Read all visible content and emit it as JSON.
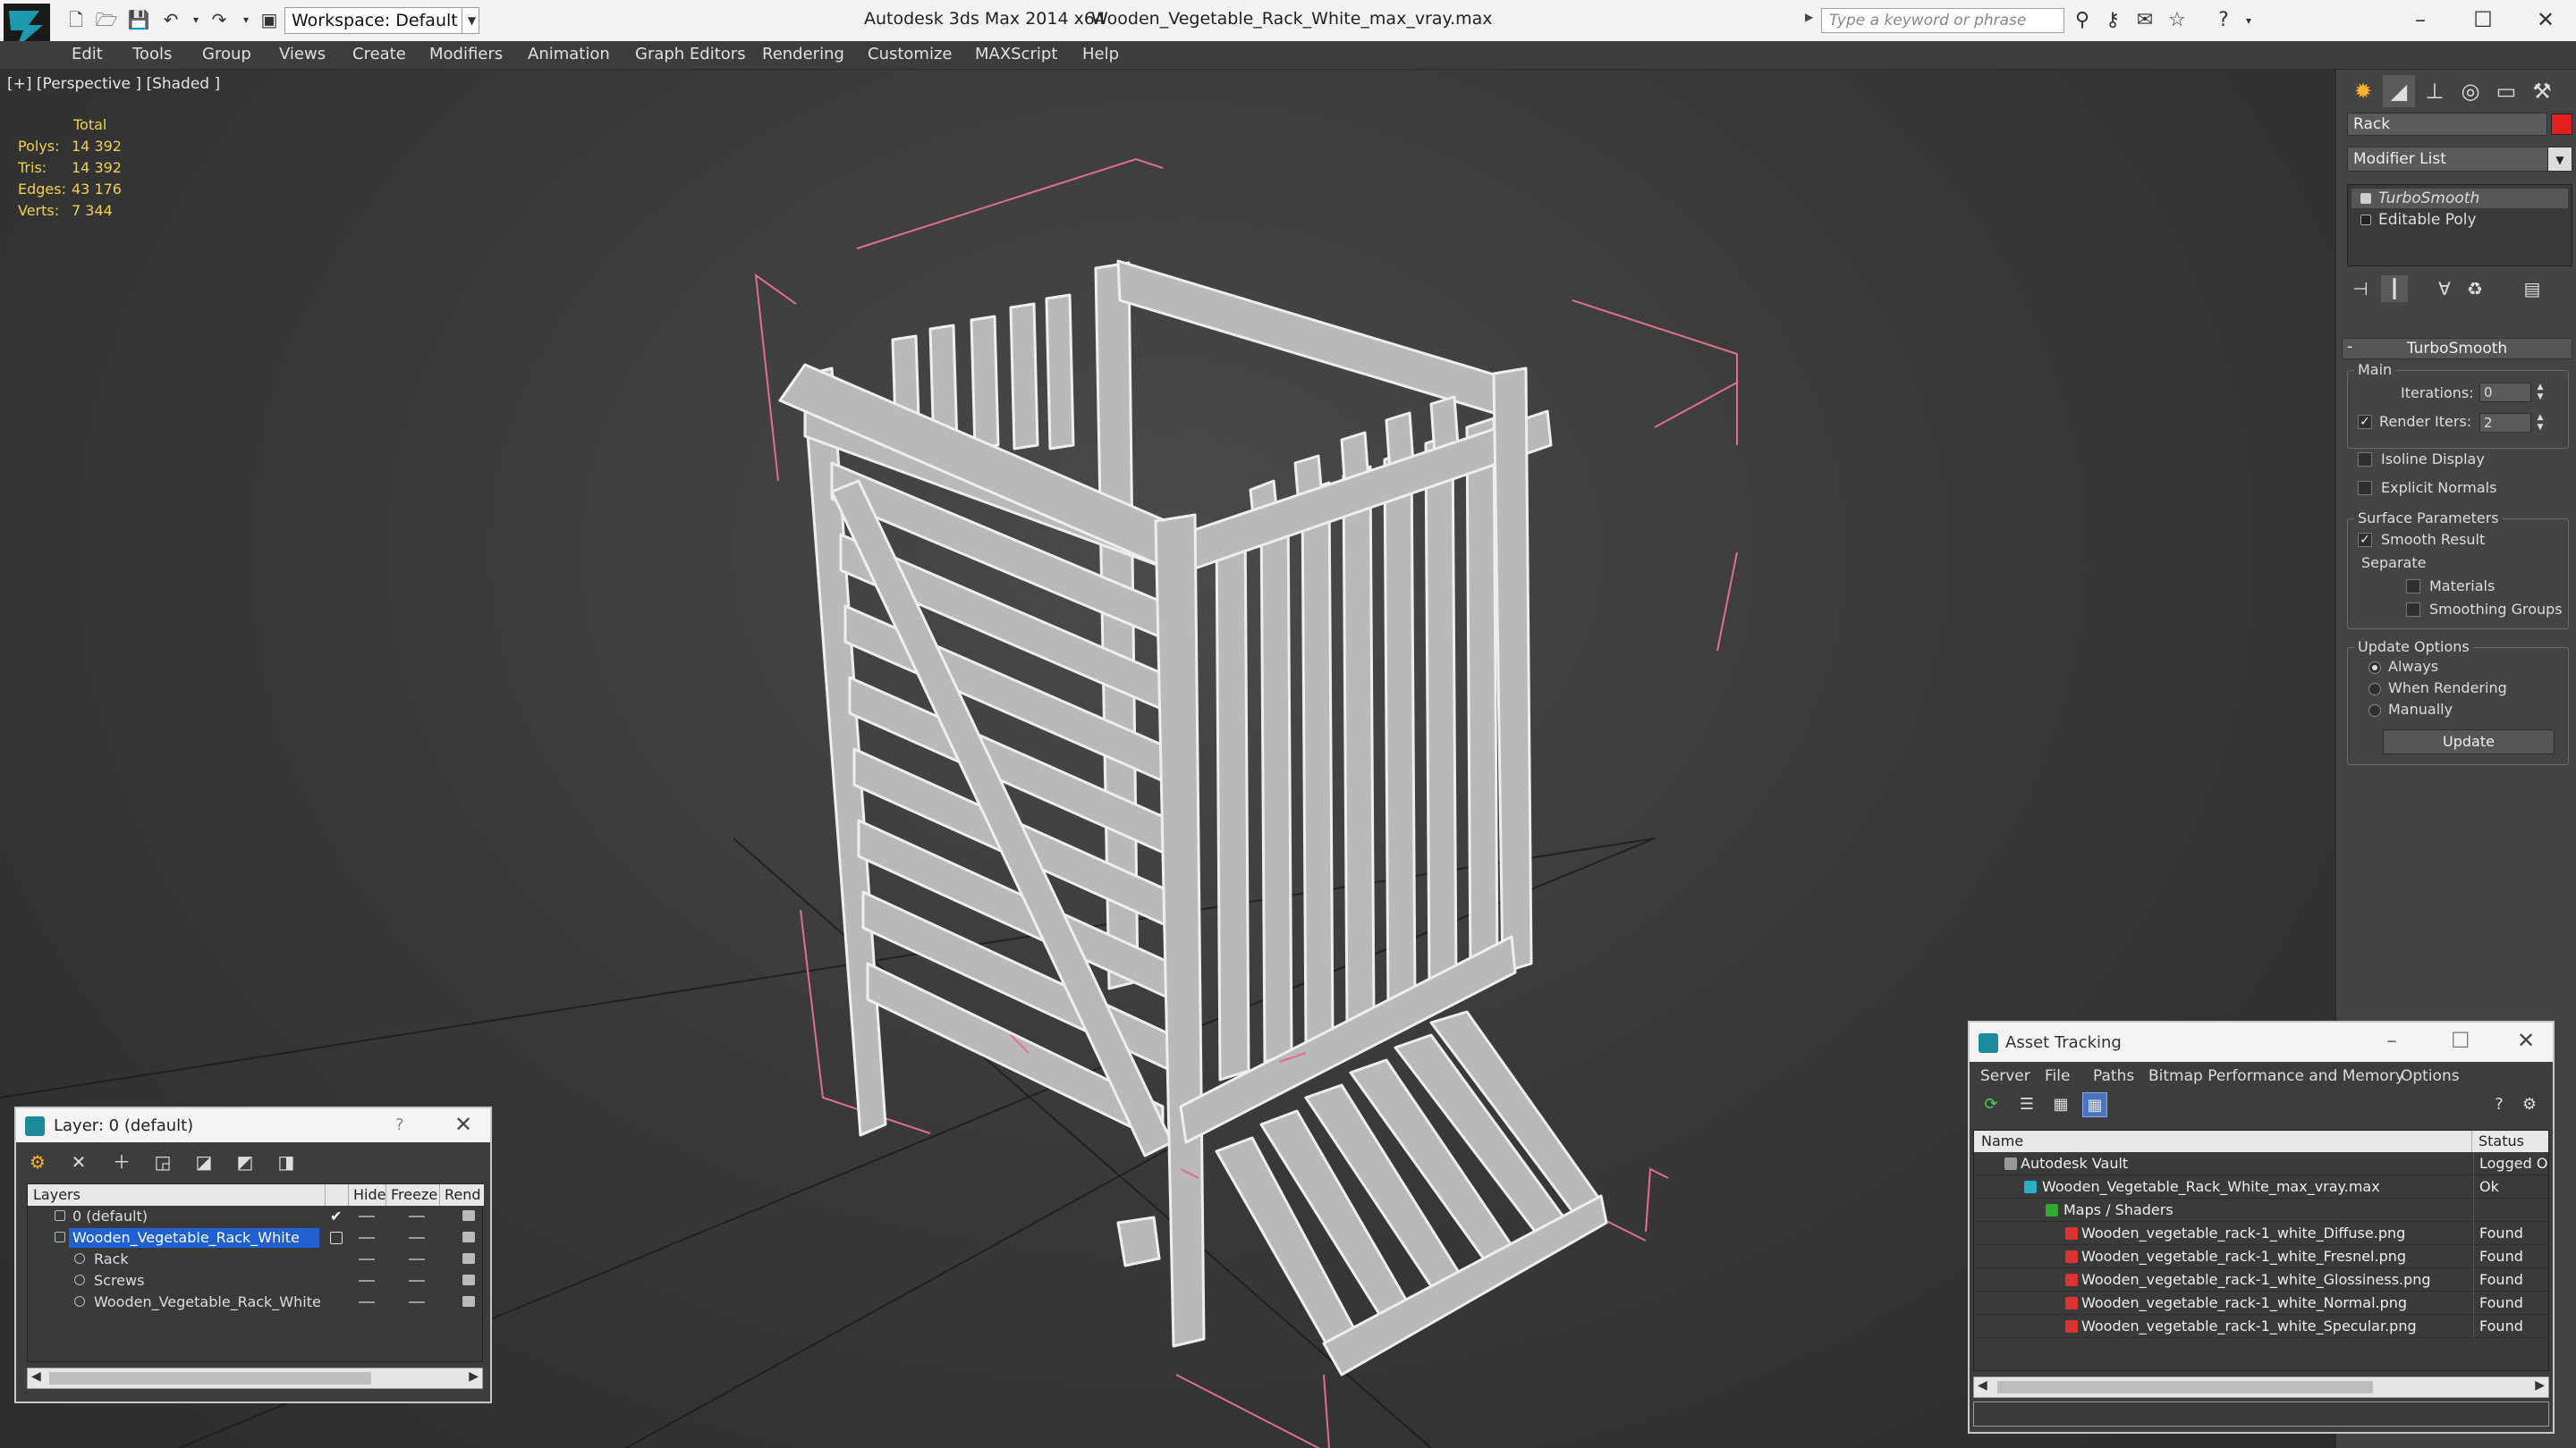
{
  "titlebar": {
    "workspace": "Workspace: Default",
    "app_title": "Autodesk 3ds Max  2014 x64",
    "file_title": "Wooden_Vegetable_Rack_White_max_vray.max",
    "search_placeholder": "Type a keyword or phrase"
  },
  "menu": [
    "Edit",
    "Tools",
    "Group",
    "Views",
    "Create",
    "Modifiers",
    "Animation",
    "Graph Editors",
    "Rendering",
    "Customize",
    "MAXScript",
    "Help"
  ],
  "viewport": {
    "label": "[+] [Perspective ] [Shaded ]",
    "stats_header": "Total",
    "stats": [
      {
        "label": "Polys:",
        "value": "14 392"
      },
      {
        "label": "Tris:",
        "value": "14 392"
      },
      {
        "label": "Edges:",
        "value": "43 176"
      },
      {
        "label": "Verts:",
        "value": "7 344"
      }
    ]
  },
  "command_panel": {
    "object_name": "Rack",
    "object_color": "#e02020",
    "modifier_list": "Modifier List",
    "stack": [
      "TurboSmooth",
      "Editable Poly"
    ],
    "rollout_title": "TurboSmooth",
    "main_group": "Main",
    "iterations_label": "Iterations:",
    "iterations_value": "0",
    "render_iters_label": "Render Iters:",
    "render_iters_value": "2",
    "isoline_display": "Isoline Display",
    "explicit_normals": "Explicit Normals",
    "surface_group": "Surface Parameters",
    "smooth_result": "Smooth Result",
    "separate": "Separate",
    "materials": "Materials",
    "smoothing_groups": "Smoothing Groups",
    "update_group": "Update Options",
    "always": "Always",
    "when_rendering": "When Rendering",
    "manually": "Manually",
    "update_button": "Update"
  },
  "layer_manager": {
    "title": "Layer: 0 (default)",
    "help": "?",
    "columns": [
      "Layers",
      "Hide",
      "Freeze",
      "Rend"
    ],
    "rows": [
      {
        "name": "0 (default)",
        "indent": 1,
        "selected": false
      },
      {
        "name": "Wooden_Vegetable_Rack_White",
        "indent": 1,
        "selected": true
      },
      {
        "name": "Rack",
        "indent": 2,
        "selected": false
      },
      {
        "name": "Screws",
        "indent": 2,
        "selected": false
      },
      {
        "name": "Wooden_Vegetable_Rack_White",
        "indent": 2,
        "selected": false
      }
    ]
  },
  "asset_tracking": {
    "title": "Asset Tracking",
    "menu": [
      "Server",
      "File",
      "Paths",
      "Bitmap Performance and Memory",
      "Options"
    ],
    "columns": [
      "Name",
      "Status"
    ],
    "rows": [
      {
        "name": "Autodesk Vault",
        "status": "Logged O",
        "indent": 1,
        "icon": "vault-icon"
      },
      {
        "name": "Wooden_Vegetable_Rack_White_max_vray.max",
        "status": "Ok",
        "indent": 2,
        "icon": "max-file-icon"
      },
      {
        "name": "Maps / Shaders",
        "status": "",
        "indent": 3,
        "icon": "maps-folder-icon"
      },
      {
        "name": "Wooden_vegetable_rack-1_white_Diffuse.png",
        "status": "Found",
        "indent": 4,
        "icon": "png-icon"
      },
      {
        "name": "Wooden_vegetable_rack-1_white_Fresnel.png",
        "status": "Found",
        "indent": 4,
        "icon": "png-icon"
      },
      {
        "name": "Wooden_vegetable_rack-1_white_Glossiness.png",
        "status": "Found",
        "indent": 4,
        "icon": "png-icon"
      },
      {
        "name": "Wooden_vegetable_rack-1_white_Normal.png",
        "status": "Found",
        "indent": 4,
        "icon": "png-icon"
      },
      {
        "name": "Wooden_vegetable_rack-1_white_Specular.png",
        "status": "Found",
        "indent": 4,
        "icon": "png-icon"
      }
    ]
  }
}
